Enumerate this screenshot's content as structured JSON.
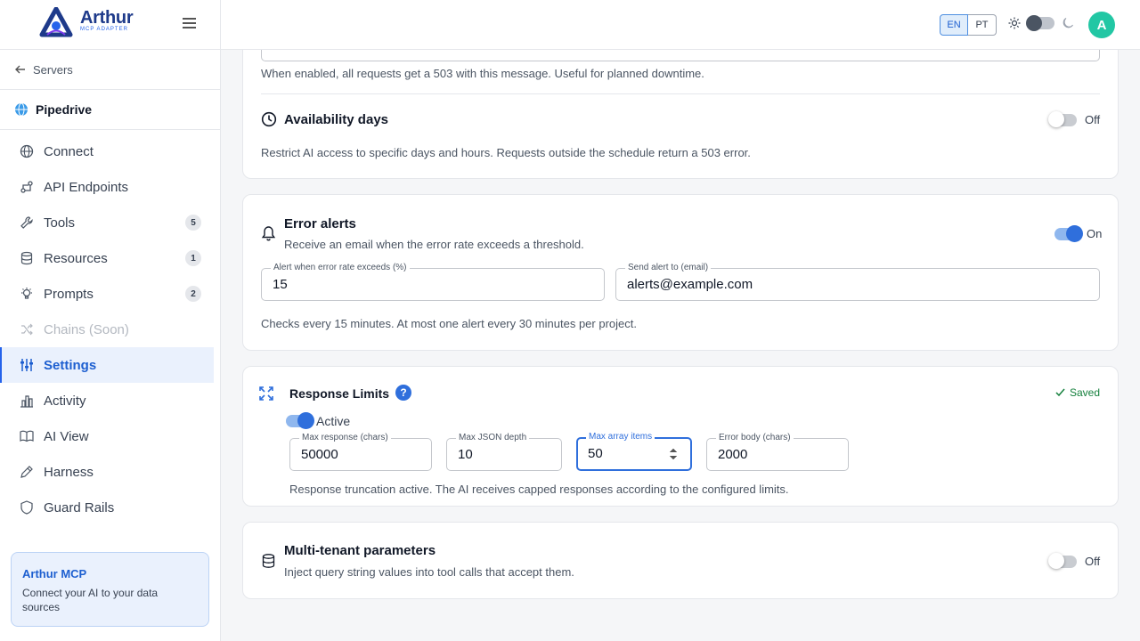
{
  "brand": {
    "name": "Arthur",
    "subtitle": "MCP ADAPTER"
  },
  "sidebar": {
    "back_label": "Servers",
    "server_name": "Pipedrive",
    "items": [
      {
        "label": "Connect",
        "icon": "globe-icon",
        "badge": ""
      },
      {
        "label": "API Endpoints",
        "icon": "api-icon",
        "badge": ""
      },
      {
        "label": "Tools",
        "icon": "wrench-icon",
        "badge": "5"
      },
      {
        "label": "Resources",
        "icon": "database-icon",
        "badge": "1"
      },
      {
        "label": "Prompts",
        "icon": "lightbulb-icon",
        "badge": "2"
      },
      {
        "label": "Chains (Soon)",
        "icon": "shuffle-icon",
        "badge": ""
      },
      {
        "label": "Settings",
        "icon": "sliders-icon",
        "badge": ""
      },
      {
        "label": "Activity",
        "icon": "chart-icon",
        "badge": ""
      },
      {
        "label": "AI View",
        "icon": "book-icon",
        "badge": ""
      },
      {
        "label": "Harness",
        "icon": "pen-icon",
        "badge": ""
      },
      {
        "label": "Guard Rails",
        "icon": "shield-icon",
        "badge": ""
      }
    ],
    "promo": {
      "title": "Arthur MCP",
      "text": "Connect your AI to your data sources"
    }
  },
  "header": {
    "languages": [
      "EN",
      "PT"
    ],
    "active_language": "EN",
    "avatar_initial": "A"
  },
  "maintenance": {
    "help": "When enabled, all requests get a 503 with this message. Useful for planned downtime."
  },
  "availability": {
    "title": "Availability days",
    "toggle_label": "Off",
    "description": "Restrict AI access to specific days and hours. Requests outside the schedule return a 503 error."
  },
  "error_alerts": {
    "title": "Error alerts",
    "subtitle": "Receive an email when the error rate exceeds a threshold.",
    "toggle_label": "On",
    "threshold_label": "Alert when error rate exceeds (%)",
    "threshold_value": "15",
    "email_label": "Send alert to (email)",
    "email_value": "alerts@example.com",
    "footer": "Checks every 15 minutes. At most one alert every 30 minutes per project."
  },
  "response_limits": {
    "title": "Response Limits",
    "saved_label": "Saved",
    "active_label": "Active",
    "fields": [
      {
        "label": "Max response (chars)",
        "value": "50000"
      },
      {
        "label": "Max JSON depth",
        "value": "10"
      },
      {
        "label": "Max array items",
        "value": "50"
      },
      {
        "label": "Error body (chars)",
        "value": "2000"
      }
    ],
    "footer": "Response truncation active. The AI receives capped responses according to the configured limits."
  },
  "multi_tenant": {
    "title": "Multi-tenant parameters",
    "subtitle": "Inject query string values into tool calls that accept them.",
    "toggle_label": "Off"
  },
  "colors": {
    "accent": "#2563eb",
    "avatar": "#22c7a4",
    "success": "#15803d"
  }
}
